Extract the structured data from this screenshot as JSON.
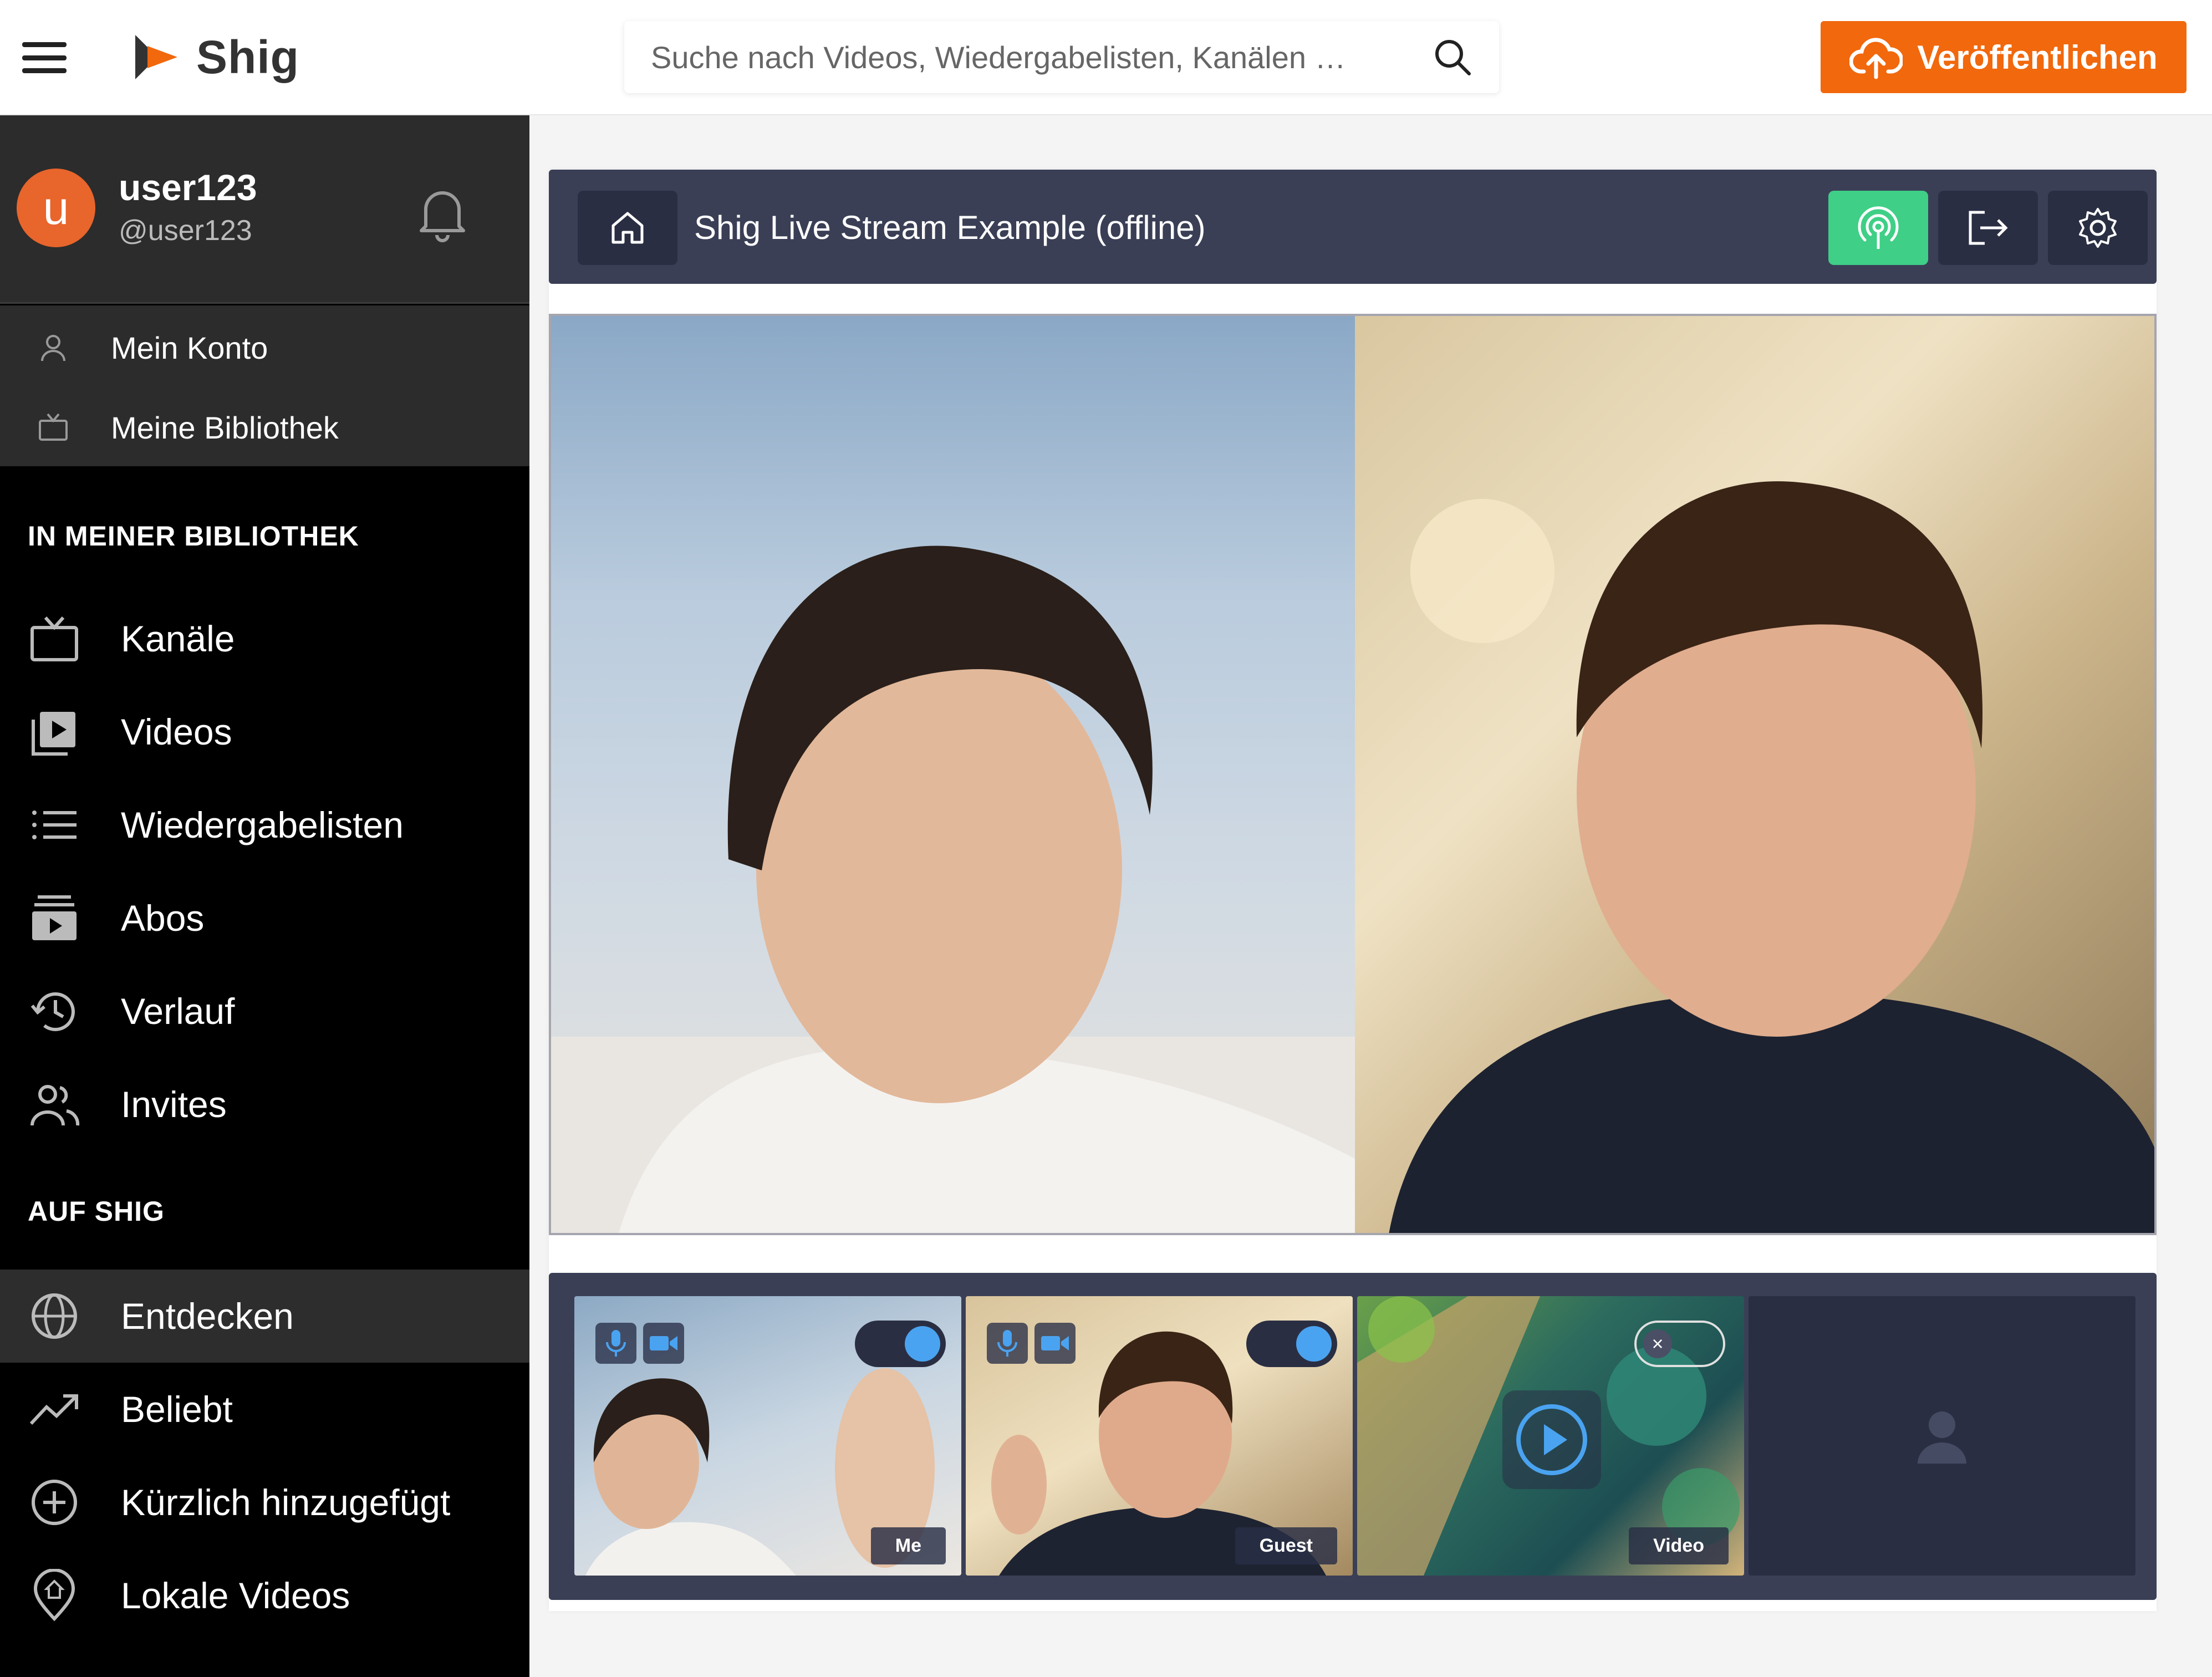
{
  "header": {
    "brand": "Shig",
    "search_placeholder": "Suche nach Videos, Wiedergabelisten, Kanälen …",
    "publish_label": "Veröffentlichen"
  },
  "user": {
    "initial": "u",
    "name": "user123",
    "handle": "@user123"
  },
  "account_menu": [
    {
      "label": "Mein Konto",
      "icon": "user-icon"
    },
    {
      "label": "Meine Bibliothek",
      "icon": "tv-icon"
    }
  ],
  "sections": {
    "library_title": "IN MEINER BIBLIOTHEK",
    "library_items": [
      {
        "label": "Kanäle",
        "icon": "tv-icon"
      },
      {
        "label": "Videos",
        "icon": "video-library-icon"
      },
      {
        "label": "Wiedergabelisten",
        "icon": "list-icon"
      },
      {
        "label": "Abos",
        "icon": "subscriptions-icon"
      },
      {
        "label": "Verlauf",
        "icon": "history-icon"
      },
      {
        "label": "Invites",
        "icon": "users-icon"
      }
    ],
    "shig_title": "AUF SHIG",
    "shig_items": [
      {
        "label": "Entdecken",
        "icon": "globe-icon",
        "active": true
      },
      {
        "label": "Beliebt",
        "icon": "trending-icon"
      },
      {
        "label": "Kürzlich hinzugefügt",
        "icon": "plus-circle-icon"
      },
      {
        "label": "Lokale Videos",
        "icon": "location-icon"
      }
    ]
  },
  "stream": {
    "title": "Shig Live Stream Example (offline)",
    "live_color": "#3fcf86"
  },
  "tiles": [
    {
      "label": "Me",
      "toggle_on": true
    },
    {
      "label": "Guest",
      "toggle_on": true
    },
    {
      "label": "Video"
    }
  ],
  "colors": {
    "accent": "#f1680d",
    "panel": "#3a3f56",
    "toggle_knob": "#4aa3f0"
  }
}
